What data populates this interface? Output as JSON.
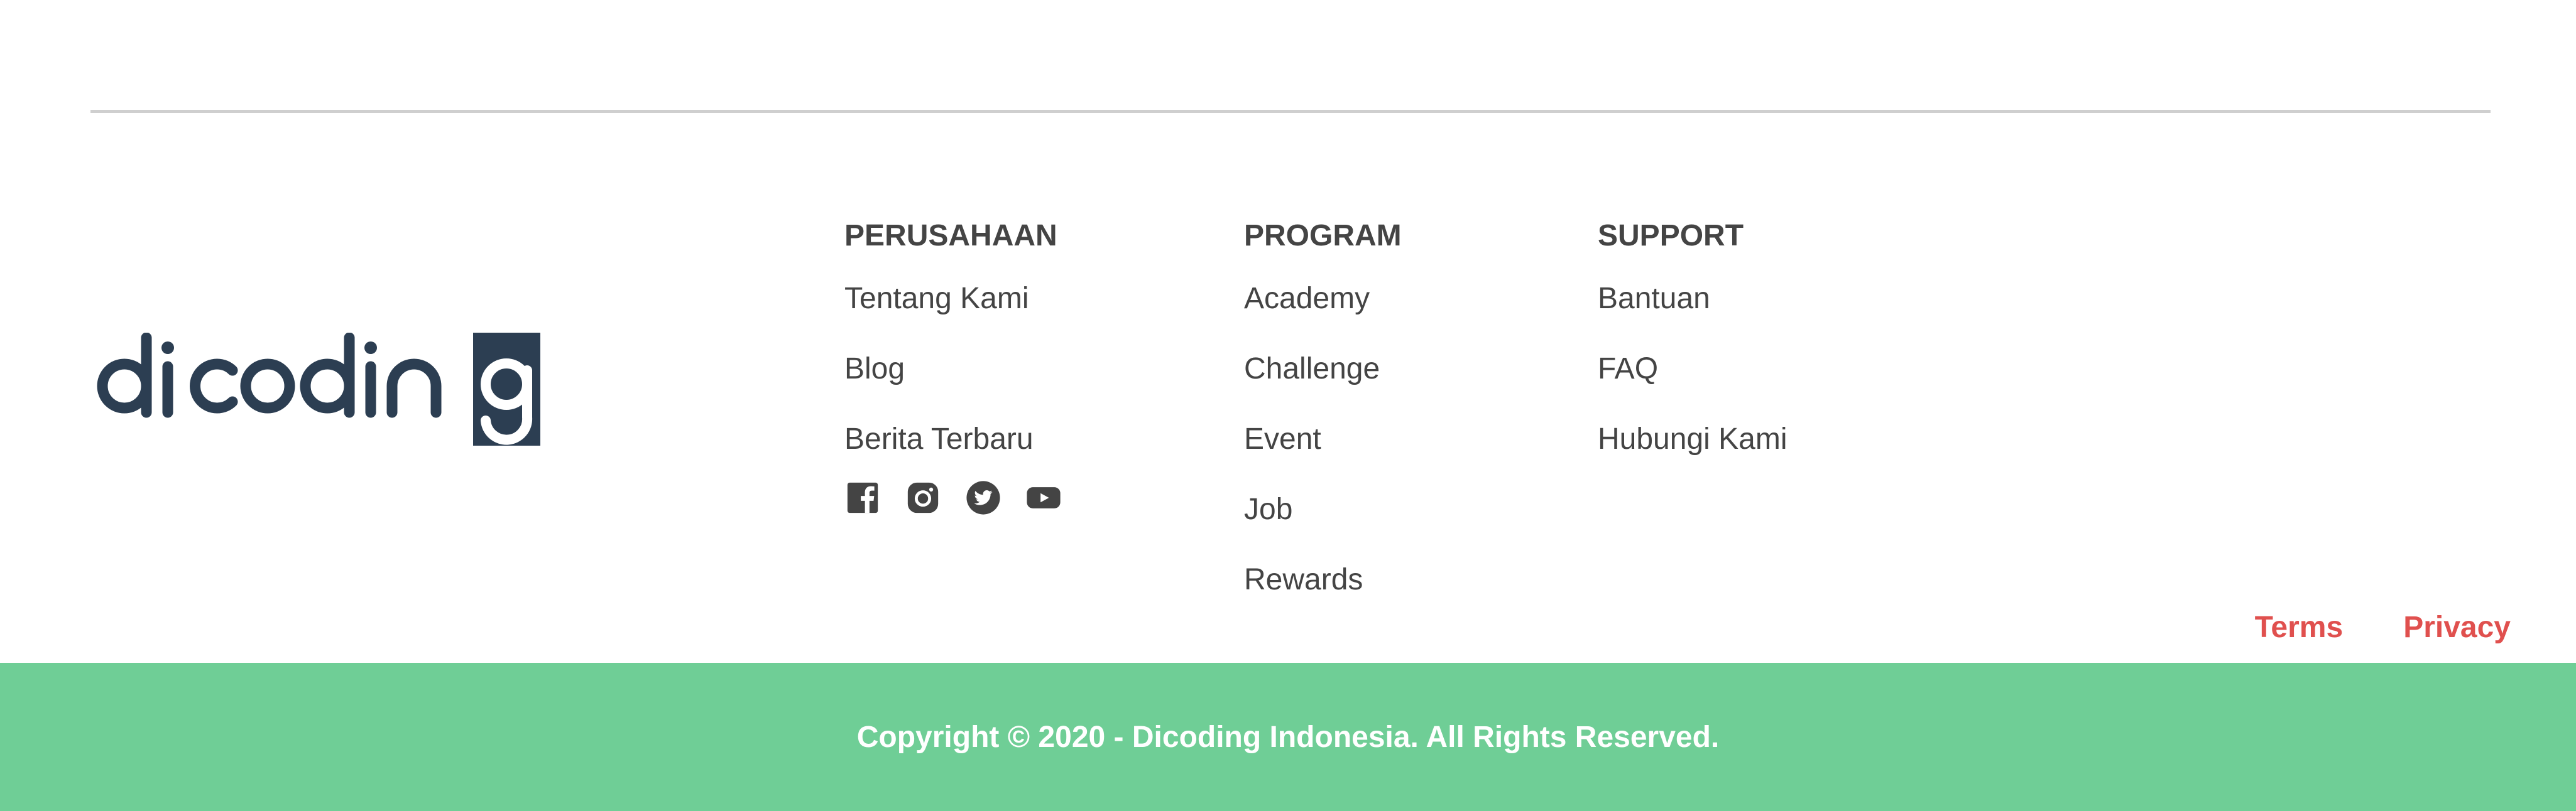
{
  "brand": {
    "logo_text": "dicoding",
    "logo_color": "#2c3e52"
  },
  "columns": {
    "company": {
      "heading": "PERUSAHAAN",
      "links": [
        "Tentang Kami",
        "Blog",
        "Berita Terbaru"
      ]
    },
    "program": {
      "heading": "PROGRAM",
      "links": [
        "Academy",
        "Challenge",
        "Event",
        "Job",
        "Rewards"
      ]
    },
    "support": {
      "heading": "SUPPORT",
      "links": [
        "Bantuan",
        "FAQ",
        "Hubungi Kami"
      ]
    }
  },
  "social_icons": [
    "facebook-icon",
    "instagram-icon",
    "twitter-icon",
    "youtube-icon"
  ],
  "legal": {
    "terms": "Terms",
    "privacy": "Privacy"
  },
  "copyright": "Copyright © 2020 - Dicoding Indonesia. All Rights Reserved.",
  "colors": {
    "accent_red": "#e0504e",
    "footer_green": "#6fce96",
    "text": "#444444"
  }
}
